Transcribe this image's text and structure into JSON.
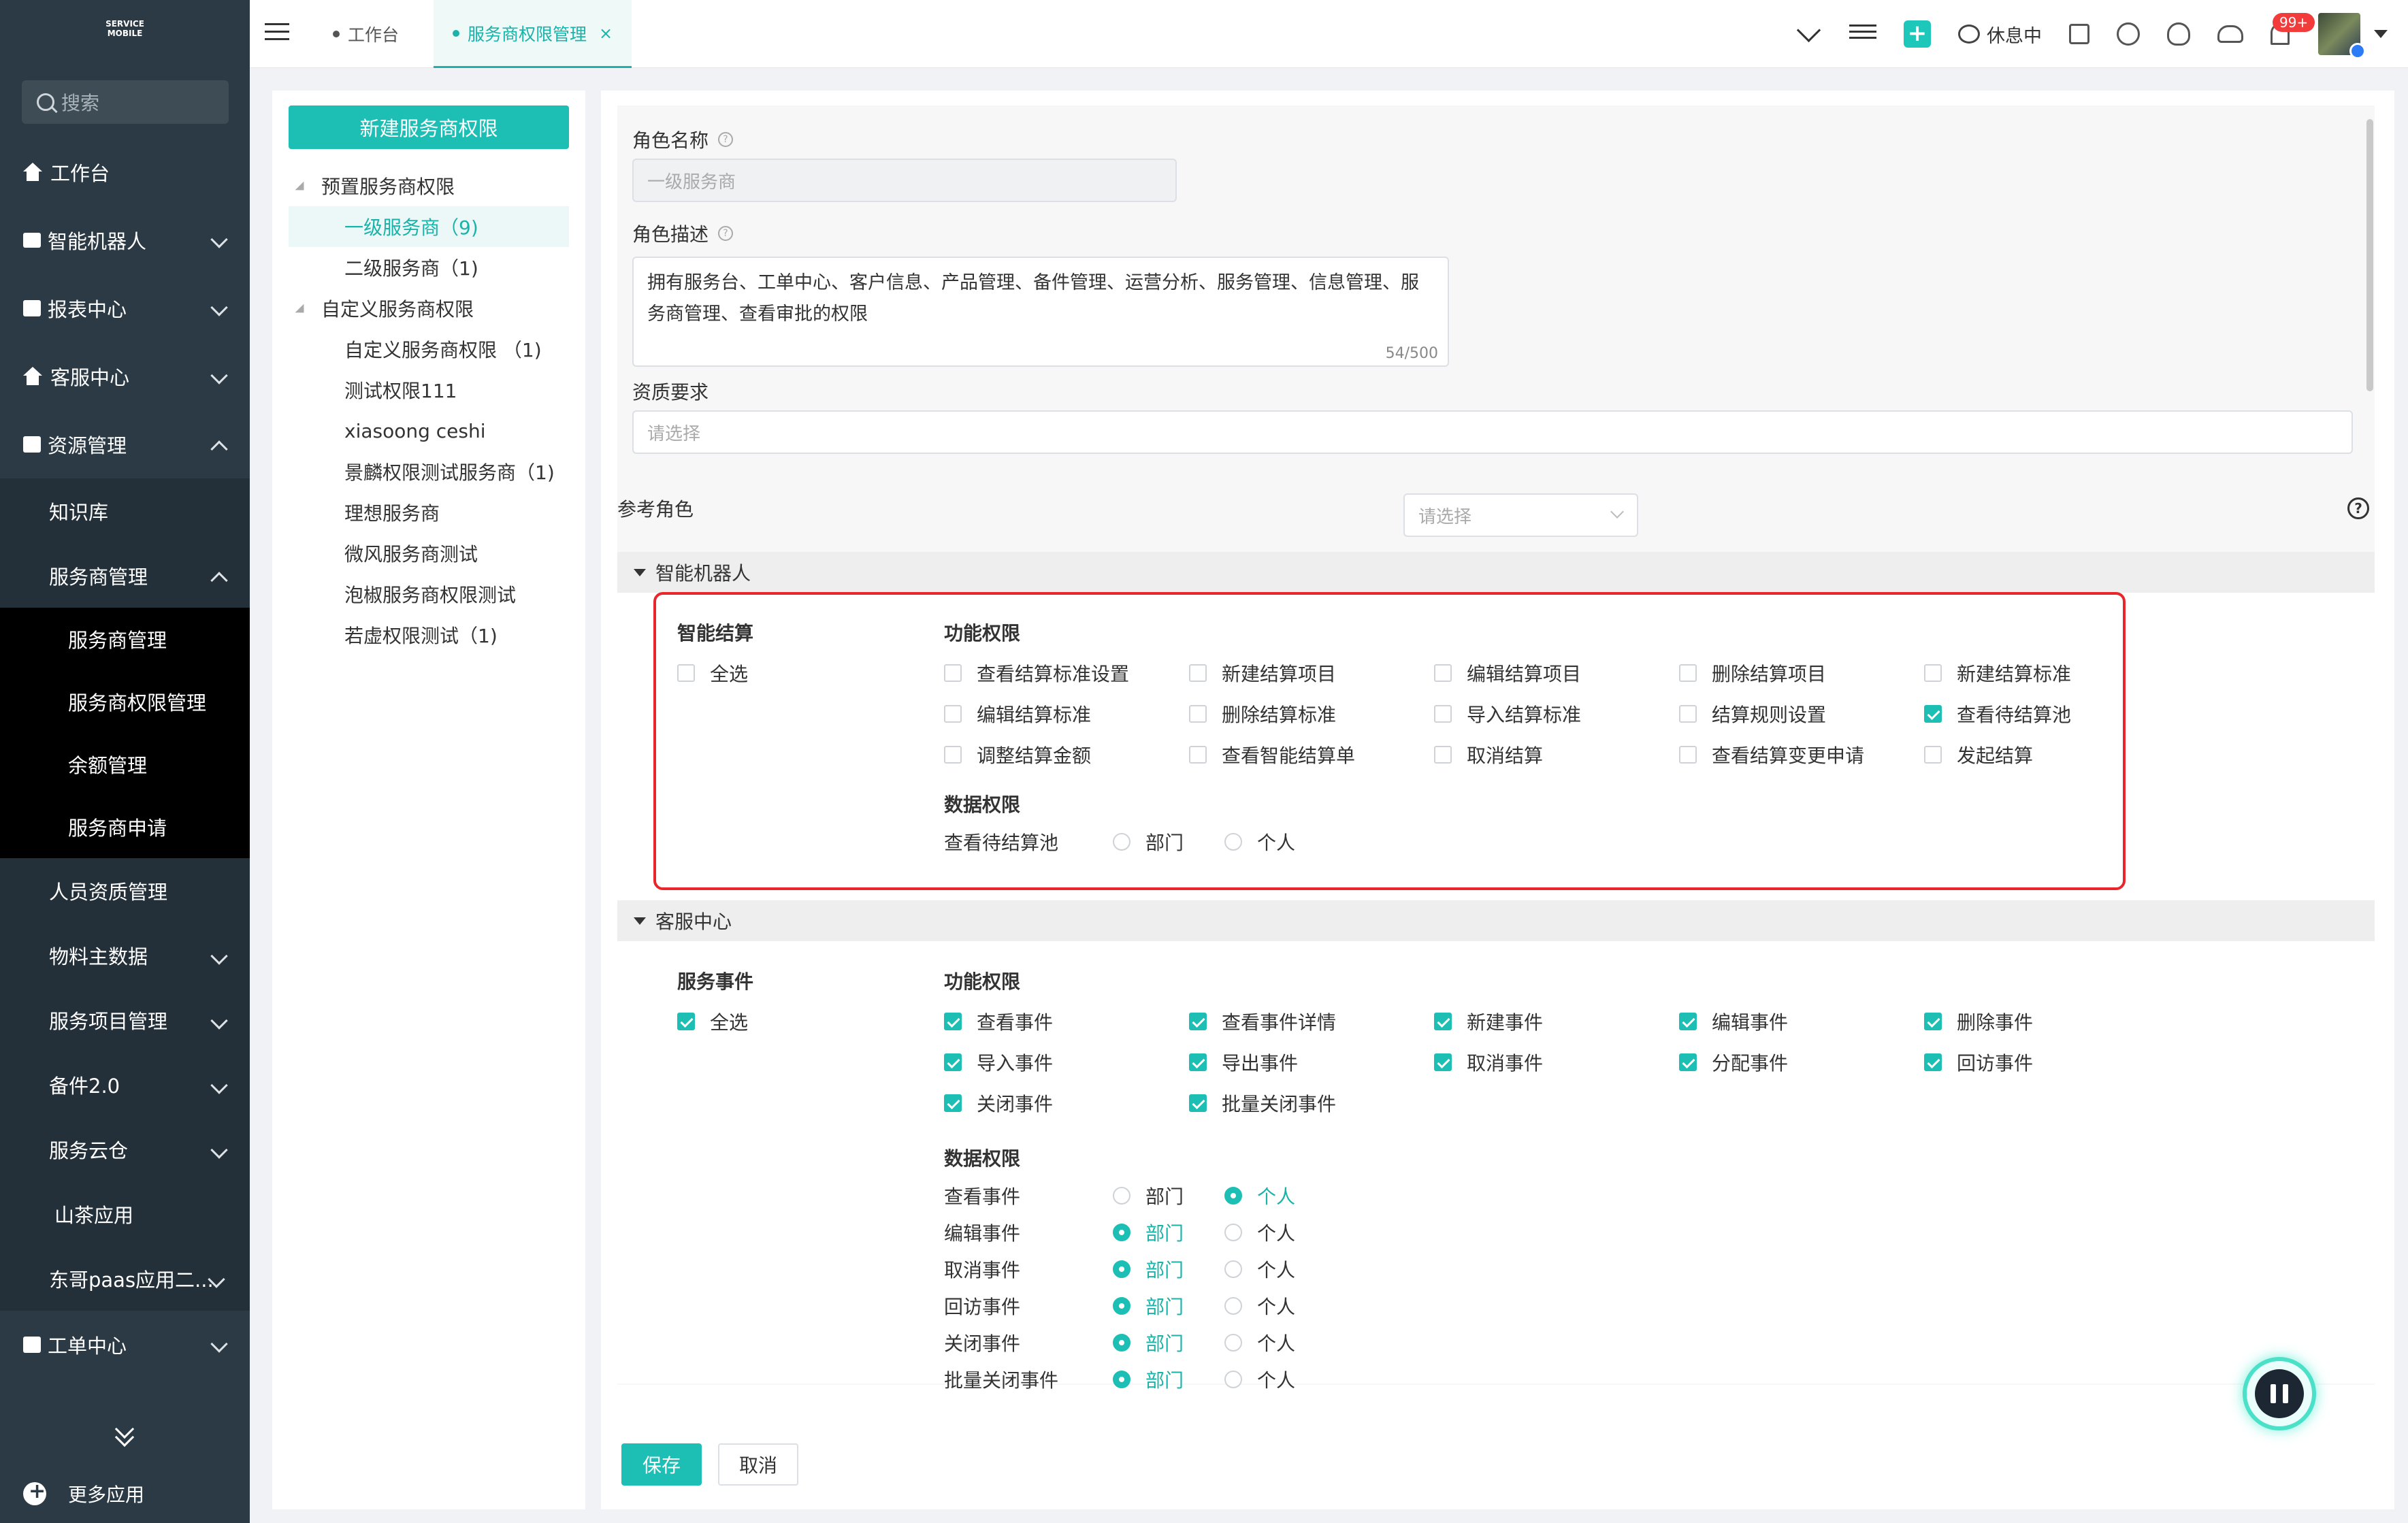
{
  "sidebar": {
    "logo_text": "SERVICE MOBILE",
    "search_placeholder": "搜索",
    "items": [
      {
        "label": "工作台",
        "icon": "home-icon"
      },
      {
        "label": "智能机器人",
        "icon": "robot-icon"
      },
      {
        "label": "报表中心",
        "icon": "report-icon"
      },
      {
        "label": "客服中心",
        "icon": "service-icon"
      },
      {
        "label": "资源管理",
        "icon": "resource-icon"
      }
    ],
    "sub_items": [
      "知识库",
      "服务商管理"
    ],
    "sub2_items": [
      "服务商管理",
      "服务商权限管理",
      "余额管理",
      "服务商申请"
    ],
    "more_items": [
      "人员资质管理",
      "物料主数据",
      "服务项目管理",
      "备件2.0",
      "服务云仓",
      "山茶应用",
      "东哥paas应用二..."
    ],
    "bottom_item": "工单中心",
    "more_apps": "更多应用"
  },
  "topbar": {
    "tab_workbench": "工作台",
    "tab_active": "服务商权限管理",
    "tab_close": "×",
    "rest_status": "休息中",
    "badge": "99+"
  },
  "tree": {
    "new_button": "新建服务商权限",
    "nodes": [
      {
        "label": "预置服务商权限",
        "level": 0
      },
      {
        "label": "一级服务商（9)",
        "level": 1,
        "selected": true
      },
      {
        "label": "二级服务商（1)",
        "level": 1
      },
      {
        "label": "自定义服务商权限",
        "level": 0
      },
      {
        "label": "自定义服务商权限 （1)",
        "level": 1
      },
      {
        "label": "测试权限111",
        "level": 1
      },
      {
        "label": "xiasoong ceshi",
        "level": 1
      },
      {
        "label": "景麟权限测试服务商（1)",
        "level": 1
      },
      {
        "label": "理想服务商",
        "level": 1
      },
      {
        "label": "微风服务商测试",
        "level": 1
      },
      {
        "label": "泡椒服务商权限测试",
        "level": 1
      },
      {
        "label": "若虚权限测试（1)",
        "level": 1
      }
    ]
  },
  "form": {
    "role_name_label": "角色名称",
    "role_name_value": "一级服务商",
    "role_desc_label": "角色描述",
    "role_desc_value": "拥有服务台、工单中心、客户信息、产品管理、备件管理、运营分析、服务管理、信息管理、服务商管理、查看审批的权限",
    "role_desc_count": "54/500",
    "qualification_label": "资质要求",
    "qualification_placeholder": "请选择",
    "ref_role_label": "参考角色",
    "ref_role_placeholder": "请选择",
    "help_glyph": "?"
  },
  "robot_section": {
    "title": "智能机器人",
    "group": "智能结算",
    "select_all": "全选",
    "select_all_checked": false,
    "func_label": "功能权限",
    "perms": [
      {
        "label": "查看结算标准设置",
        "checked": false
      },
      {
        "label": "新建结算项目",
        "checked": false
      },
      {
        "label": "编辑结算项目",
        "checked": false
      },
      {
        "label": "删除结算项目",
        "checked": false
      },
      {
        "label": "新建结算标准",
        "checked": false
      },
      {
        "label": "编辑结算标准",
        "checked": false
      },
      {
        "label": "删除结算标准",
        "checked": false
      },
      {
        "label": "导入结算标准",
        "checked": false
      },
      {
        "label": "结算规则设置",
        "checked": false
      },
      {
        "label": "查看待结算池",
        "checked": true
      },
      {
        "label": "调整结算金额",
        "checked": false
      },
      {
        "label": "查看智能结算单",
        "checked": false
      },
      {
        "label": "取消结算",
        "checked": false
      },
      {
        "label": "查看结算变更申请",
        "checked": false
      },
      {
        "label": "发起结算",
        "checked": false
      }
    ],
    "data_label": "数据权限",
    "data_perms": [
      {
        "label": "查看待结算池",
        "dept": "部门",
        "personal": "个人",
        "value": "none"
      }
    ]
  },
  "service_section": {
    "title": "客服中心",
    "group": "服务事件",
    "select_all": "全选",
    "select_all_checked": true,
    "func_label": "功能权限",
    "perms": [
      {
        "label": "查看事件",
        "checked": true
      },
      {
        "label": "查看事件详情",
        "checked": true
      },
      {
        "label": "新建事件",
        "checked": true
      },
      {
        "label": "编辑事件",
        "checked": true
      },
      {
        "label": "删除事件",
        "checked": true
      },
      {
        "label": "导入事件",
        "checked": true
      },
      {
        "label": "导出事件",
        "checked": true
      },
      {
        "label": "取消事件",
        "checked": true
      },
      {
        "label": "分配事件",
        "checked": true
      },
      {
        "label": "回访事件",
        "checked": true
      },
      {
        "label": "关闭事件",
        "checked": true
      },
      {
        "label": "批量关闭事件",
        "checked": true
      }
    ],
    "data_label": "数据权限",
    "data_perms": [
      {
        "label": "查看事件",
        "dept": "部门",
        "personal": "个人",
        "value": "personal"
      },
      {
        "label": "编辑事件",
        "dept": "部门",
        "personal": "个人",
        "value": "dept"
      },
      {
        "label": "取消事件",
        "dept": "部门",
        "personal": "个人",
        "value": "dept"
      },
      {
        "label": "回访事件",
        "dept": "部门",
        "personal": "个人",
        "value": "dept"
      },
      {
        "label": "关闭事件",
        "dept": "部门",
        "personal": "个人",
        "value": "dept"
      },
      {
        "label": "批量关闭事件",
        "dept": "部门",
        "personal": "个人",
        "value": "dept"
      }
    ]
  },
  "footer": {
    "save": "保存",
    "cancel": "取消"
  },
  "colors": {
    "accent": "#1dbfb5",
    "sidebar_bg": "#2b3a44",
    "highlight_border": "#e8262b"
  }
}
